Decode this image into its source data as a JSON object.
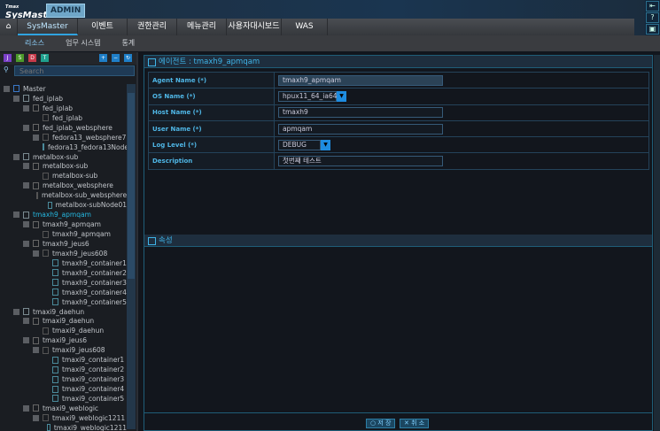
{
  "header": {
    "logo_small": "Tmax",
    "logo": "SysMaster",
    "role_badge": "ADMIN"
  },
  "nav": {
    "home_icon": "home-icon",
    "tabs": [
      "SysMaster",
      "이벤트",
      "권한관리",
      "메뉴관리",
      "사용자대시보드",
      "WAS"
    ]
  },
  "subnav": [
    "리소스",
    "업무 시스템",
    "통계"
  ],
  "right_icons": [
    "logout-icon",
    "help-icon",
    "monitor-icon"
  ],
  "right_icon_glyphs": [
    "⇤",
    "?",
    "▣"
  ],
  "sidebar": {
    "search_placeholder": "Search",
    "tree": [
      {
        "label": "Master",
        "level": 0
      },
      {
        "label": "fed_iplab",
        "level": 1
      },
      {
        "label": "fed_iplab",
        "level": 2
      },
      {
        "label": "fed_iplab",
        "level": 3
      },
      {
        "label": "fed_iplab_websphere",
        "level": 2
      },
      {
        "label": "fedora13_websphere7",
        "level": 3
      },
      {
        "label": "fedora13_fedora13Node",
        "level": 4
      },
      {
        "label": "metalbox-sub",
        "level": 1
      },
      {
        "label": "metalbox-sub",
        "level": 2
      },
      {
        "label": "metalbox-sub",
        "level": 3
      },
      {
        "label": "metalbox_websphere",
        "level": 2
      },
      {
        "label": "metalbox-sub_websphere",
        "level": 3
      },
      {
        "label": "metalbox-subNode01",
        "level": 4
      },
      {
        "label": "tmaxh9_apmqam",
        "level": 1,
        "selected": true
      },
      {
        "label": "tmaxh9_apmqam",
        "level": 2
      },
      {
        "label": "tmaxh9_apmqam",
        "level": 3
      },
      {
        "label": "tmaxh9_jeus6",
        "level": 2
      },
      {
        "label": "tmaxh9_jeus608",
        "level": 3
      },
      {
        "label": "tmaxh9_container1",
        "level": 4
      },
      {
        "label": "tmaxh9_container2",
        "level": 4
      },
      {
        "label": "tmaxh9_container3",
        "level": 4
      },
      {
        "label": "tmaxh9_container4",
        "level": 4
      },
      {
        "label": "tmaxh9_container5",
        "level": 4
      },
      {
        "label": "tmaxi9_daehun",
        "level": 1
      },
      {
        "label": "tmaxi9_daehun",
        "level": 2
      },
      {
        "label": "tmaxi9_daehun",
        "level": 3
      },
      {
        "label": "tmaxi9_jeus6",
        "level": 2
      },
      {
        "label": "tmaxi9_jeus608",
        "level": 3
      },
      {
        "label": "tmaxi9_container1",
        "level": 4
      },
      {
        "label": "tmaxi9_container2",
        "level": 4
      },
      {
        "label": "tmaxi9_container3",
        "level": 4
      },
      {
        "label": "tmaxi9_container4",
        "level": 4
      },
      {
        "label": "tmaxi9_container5",
        "level": 4
      },
      {
        "label": "tmaxi9_weblogic",
        "level": 2
      },
      {
        "label": "tmaxi9_weblogic1211",
        "level": 3
      },
      {
        "label": "tmaxi9_weblogic1211",
        "level": 4
      }
    ]
  },
  "agent": {
    "title": "에이전트 : tmaxh9_apmqam",
    "fields": [
      {
        "label": "Agent Name (*)",
        "value": "tmaxh9_apmqam",
        "type": "readonly"
      },
      {
        "label": "OS Name (*)",
        "value": "hpux11_64_ia64",
        "type": "select"
      },
      {
        "label": "Host Name (*)",
        "value": "tmaxh9",
        "type": "text"
      },
      {
        "label": "User Name (*)",
        "value": "apmqam",
        "type": "text"
      },
      {
        "label": "Log Level (*)",
        "value": "DEBUG",
        "type": "select"
      },
      {
        "label": "Description",
        "value": "첫번째 테스트",
        "type": "text"
      }
    ]
  },
  "props": {
    "title": "속성"
  },
  "buttons": {
    "save": "저 장",
    "cancel": "취 소"
  }
}
